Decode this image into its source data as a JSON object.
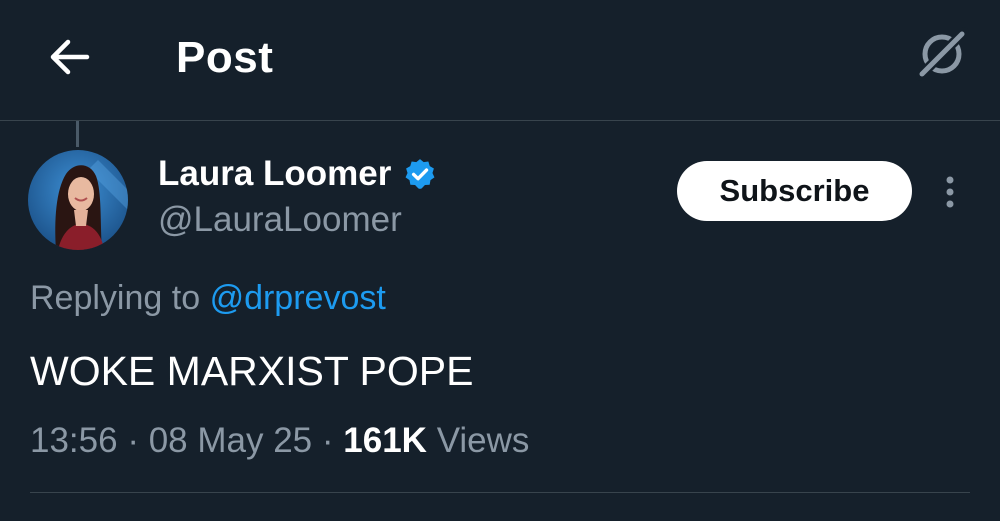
{
  "header": {
    "title": "Post",
    "back_icon": "arrow-left-icon",
    "grok_icon": "grok-icon"
  },
  "author": {
    "name": "Laura Loomer",
    "handle": "@LauraLoomer",
    "verified": true,
    "verified_color": "#1d9bf0"
  },
  "subscribe": {
    "label": "Subscribe"
  },
  "reply": {
    "prefix": "Replying to",
    "target": "@drprevost"
  },
  "post": {
    "text": "WOKE MARXIST POPE"
  },
  "meta": {
    "time": "13:56",
    "separator": "·",
    "date": "08 May 25",
    "views_count": "161K",
    "views_label": "Views"
  },
  "colors": {
    "background": "#15202b",
    "muted": "#8b98a5",
    "link": "#1d9bf0",
    "divider": "#38444d"
  }
}
